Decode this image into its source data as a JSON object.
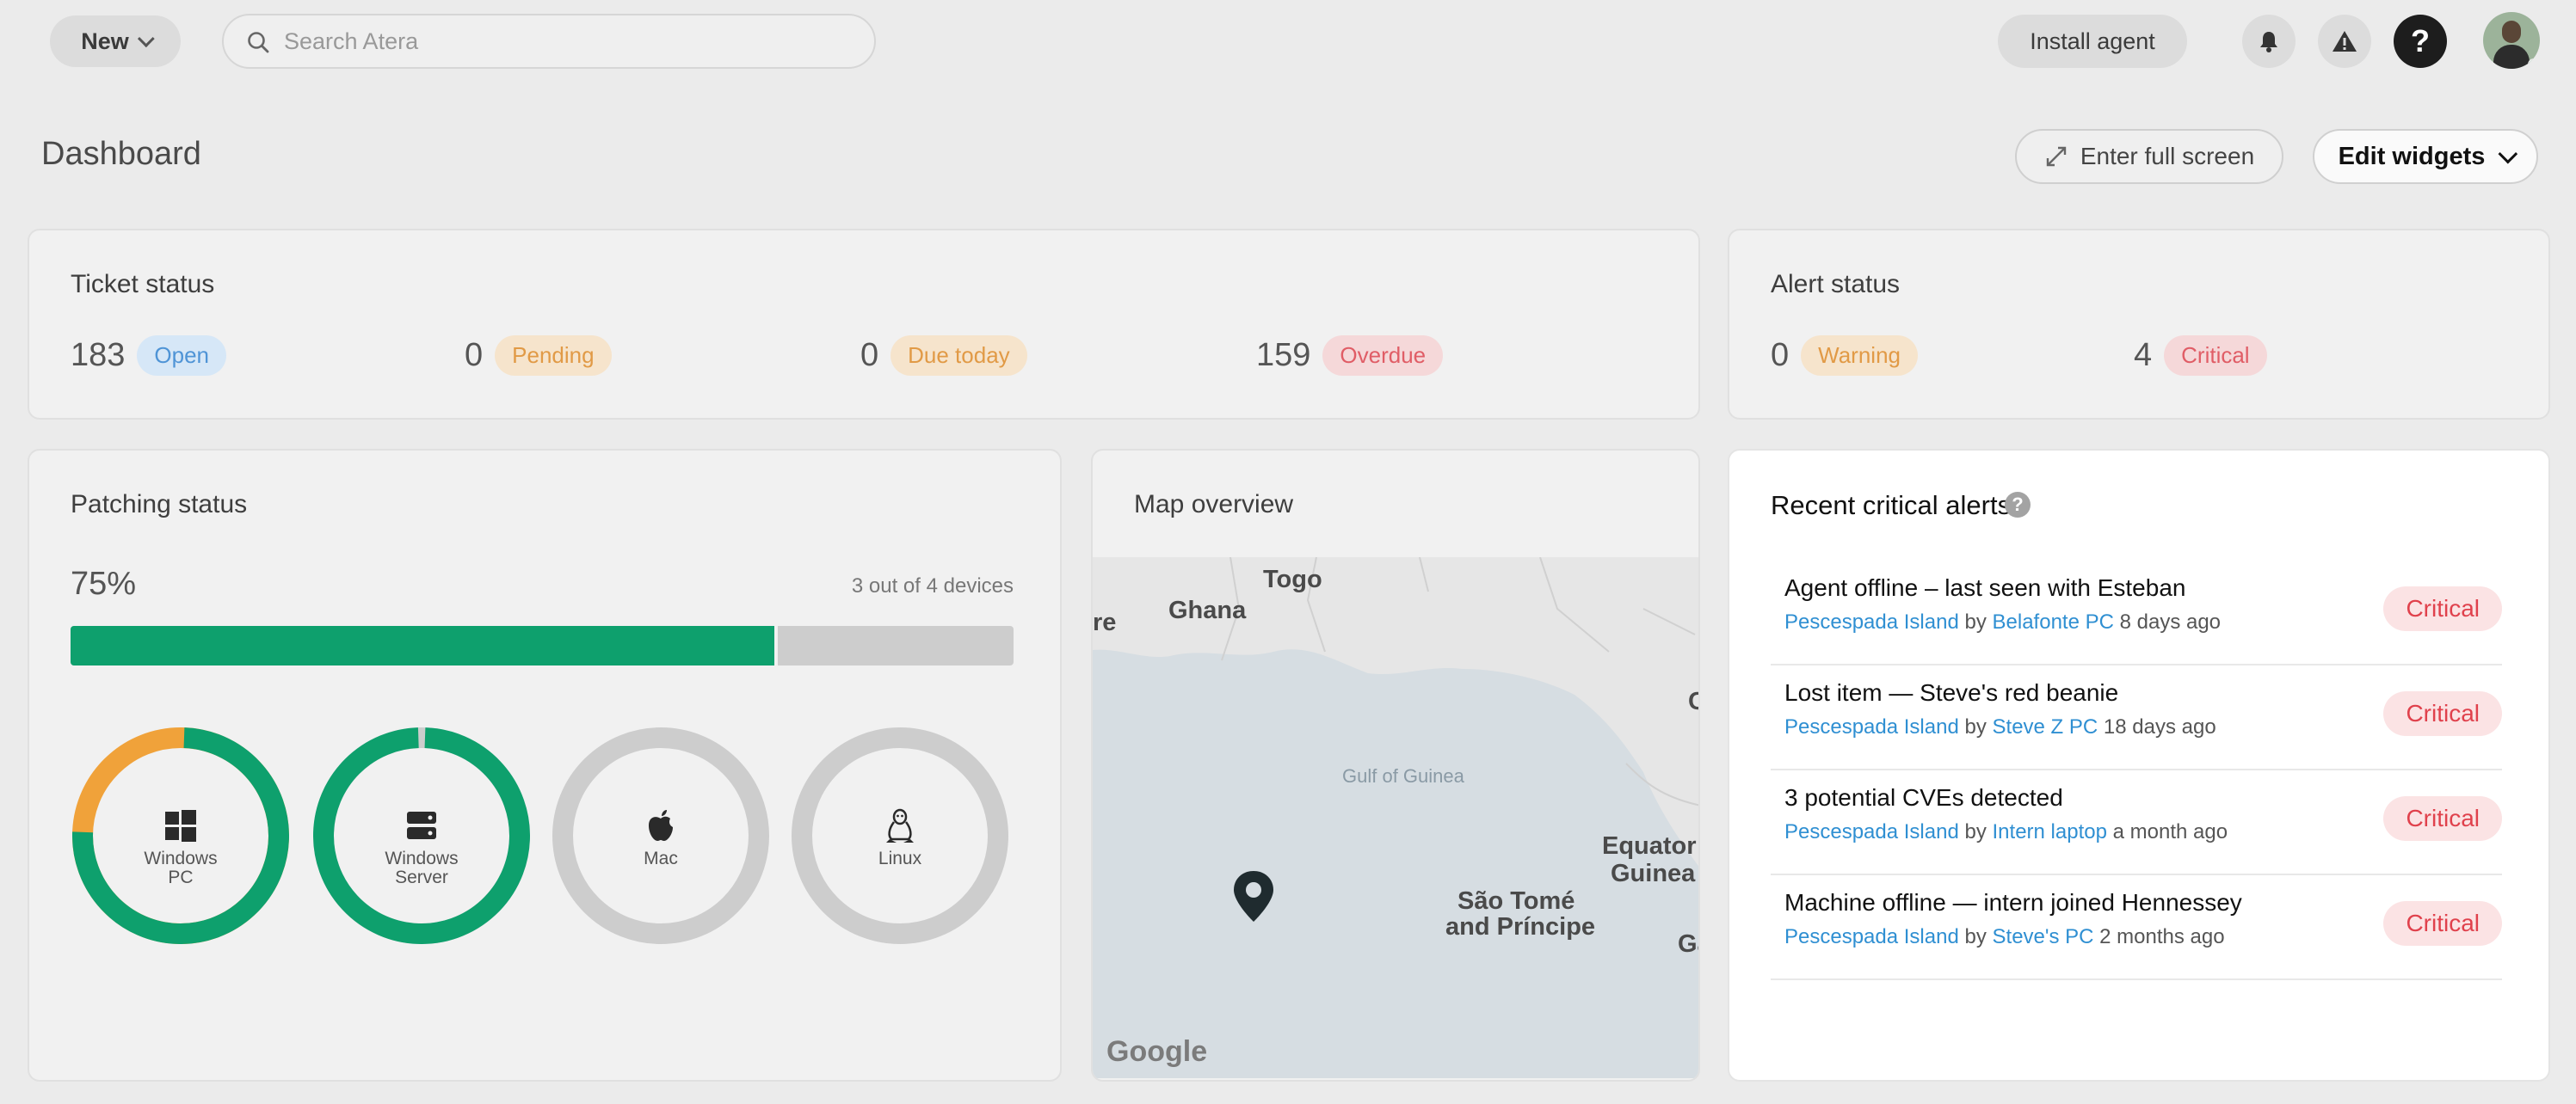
{
  "topbar": {
    "new_label": "New",
    "search_placeholder": "Search Atera",
    "install_label": "Install agent",
    "help_label": "?"
  },
  "header": {
    "title": "Dashboard",
    "fullscreen_label": "Enter full screen",
    "edit_label": "Edit widgets"
  },
  "ticket_status": {
    "title": "Ticket status",
    "stats": [
      {
        "value": "183",
        "label": "Open",
        "color": "#4f94d6"
      },
      {
        "value": "0",
        "label": "Pending",
        "color": "#e19a46"
      },
      {
        "value": "0",
        "label": "Due today",
        "color": "#e19a46"
      },
      {
        "value": "159",
        "label": "Overdue",
        "color": "#e05d66"
      }
    ]
  },
  "alert_status": {
    "title": "Alert status",
    "stats": [
      {
        "value": "0",
        "label": "Warning",
        "color": "#e19a46"
      },
      {
        "value": "4",
        "label": "Critical",
        "color": "#e05d66"
      }
    ]
  },
  "patching": {
    "title": "Patching status",
    "percent_label": "75%",
    "percent": 0.75,
    "devices_label": "3 out of 4 devices",
    "colors": {
      "ok": "#0ea06d",
      "pending": "#f0a23a",
      "empty": "#cdcdcd"
    },
    "platforms": [
      {
        "name_line1": "Windows",
        "name_line2": "PC",
        "icon": "windows-icon",
        "ok_fraction": 0.75
      },
      {
        "name_line1": "Windows",
        "name_line2": "Server",
        "icon": "server-icon",
        "ok_fraction": 1.0
      },
      {
        "name_line1": "Mac",
        "name_line2": "",
        "icon": "apple-icon",
        "ok_fraction": 0
      },
      {
        "name_line1": "Linux",
        "name_line2": "",
        "icon": "linux-icon",
        "ok_fraction": 0
      }
    ]
  },
  "map": {
    "title": "Map overview",
    "labels": {
      "togo": "Togo",
      "ghana": "Ghana",
      "re": "re",
      "gulf": "Gulf of Guinea",
      "sao_tome_1": "São Tomé",
      "sao_tome_2": "and Príncipe",
      "equator_1": "Equator",
      "equator_2": "Guinea",
      "c": "C",
      "ga": "Ga",
      "google": "Google"
    }
  },
  "recent_alerts": {
    "title": "Recent critical alerts",
    "help": "?",
    "by_label": "by",
    "items": [
      {
        "title": "Agent offline – last seen with Esteban",
        "customer": "Pescespada Island",
        "device": "Belafonte PC",
        "time": "8 days ago",
        "severity": "Critical"
      },
      {
        "title": "Lost item — Steve's red beanie",
        "customer": "Pescespada Island",
        "device": "Steve Z PC",
        "time": "18 days ago",
        "severity": "Critical"
      },
      {
        "title": "3 potential CVEs detected",
        "customer": "Pescespada Island",
        "device": "Intern laptop",
        "time": "a month ago",
        "severity": "Critical"
      },
      {
        "title": "Machine offline — intern joined Hennessey",
        "customer": "Pescespada Island",
        "device": "Steve's PC",
        "time": "2 months ago",
        "severity": "Critical"
      }
    ]
  }
}
